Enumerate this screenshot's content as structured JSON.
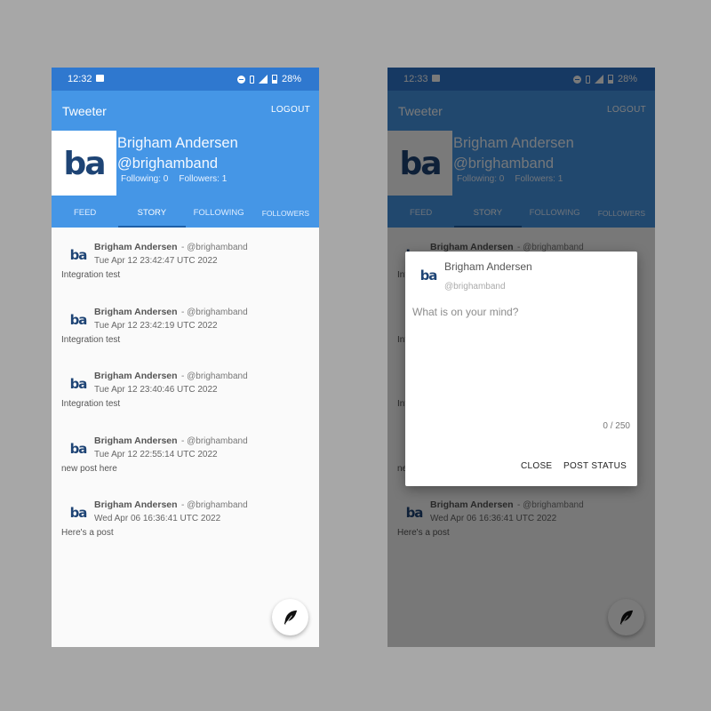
{
  "colors": {
    "status_bar": "#2f78cf",
    "app_bar": "#4596e6",
    "tab_indicator": "#1c5fa8",
    "backdrop": "#a7a7a7",
    "dim_overlay": "rgba(0,0,0,0.52)"
  },
  "screens": [
    {
      "status": {
        "time": "12:32",
        "battery": "28%"
      },
      "header": {
        "title": "Tweeter",
        "logout_label": "LOGOUT"
      },
      "profile": {
        "name": "Brigham Andersen",
        "handle": "@brighamband",
        "following": "Following: 0",
        "followers": "Followers: 1",
        "logo_text": "ba"
      },
      "tabs": [
        "FEED",
        "STORY",
        "FOLLOWING",
        "FOLLOWERS"
      ],
      "active_tab": "STORY",
      "posts": [
        {
          "name": "Brigham Andersen",
          "handle": "- @brighamband",
          "date": "Tue Apr 12 23:42:47 UTC 2022",
          "body": "Integration test"
        },
        {
          "name": "Brigham Andersen",
          "handle": "- @brighamband",
          "date": "Tue Apr 12 23:42:19 UTC 2022",
          "body": "Integration test"
        },
        {
          "name": "Brigham Andersen",
          "handle": "- @brighamband",
          "date": "Tue Apr 12 23:40:46 UTC 2022",
          "body": "Integration test"
        },
        {
          "name": "Brigham Andersen",
          "handle": "- @brighamband",
          "date": "Tue Apr 12 22:55:14 UTC 2022",
          "body": "new post here"
        },
        {
          "name": "Brigham Andersen",
          "handle": "- @brighamband",
          "date": "Wed Apr 06 16:36:41 UTC 2022",
          "body": "Here's a post"
        }
      ],
      "fab_icon": "feather-icon"
    },
    {
      "status": {
        "time": "12:33",
        "battery": "28%"
      },
      "header": {
        "title": "Tweeter",
        "logout_label": "LOGOUT"
      },
      "profile": {
        "name": "Brigham Andersen",
        "handle": "@brighamband",
        "following": "Following: 0",
        "followers": "Followers: 1",
        "logo_text": "ba"
      },
      "tabs": [
        "FEED",
        "STORY",
        "FOLLOWING",
        "FOLLOWERS"
      ],
      "active_tab": "STORY",
      "posts": [
        {
          "name": "Brigham Andersen",
          "handle": "- @brighamband",
          "date": "Tue Apr 12 23:42:47 UTC 2022",
          "body": "Integration test"
        },
        {
          "name": "Brigham Andersen",
          "handle": "- @brighamband",
          "date": "Tue Apr 12 23:42:19 UTC 2022",
          "body": "Integration test"
        },
        {
          "name": "Brigham Andersen",
          "handle": "- @brighamband",
          "date": "Tue Apr 12 23:40:46 UTC 2022",
          "body": "Integration test"
        },
        {
          "name": "Brigham Andersen",
          "handle": "- @brighamband",
          "date": "Tue Apr 12 22:55:14 UTC 2022",
          "body": "new post here"
        },
        {
          "name": "Brigham Andersen",
          "handle": "- @brighamband",
          "date": "Wed Apr 06 16:36:41 UTC 2022",
          "body": "Here's a post"
        }
      ],
      "fab_icon": "feather-icon",
      "dialog": {
        "name": "Brigham Andersen",
        "handle": "@brighamband",
        "placeholder": "What is on your mind?",
        "counter": "0 / 250",
        "close_label": "CLOSE",
        "post_label": "POST STATUS"
      }
    }
  ]
}
